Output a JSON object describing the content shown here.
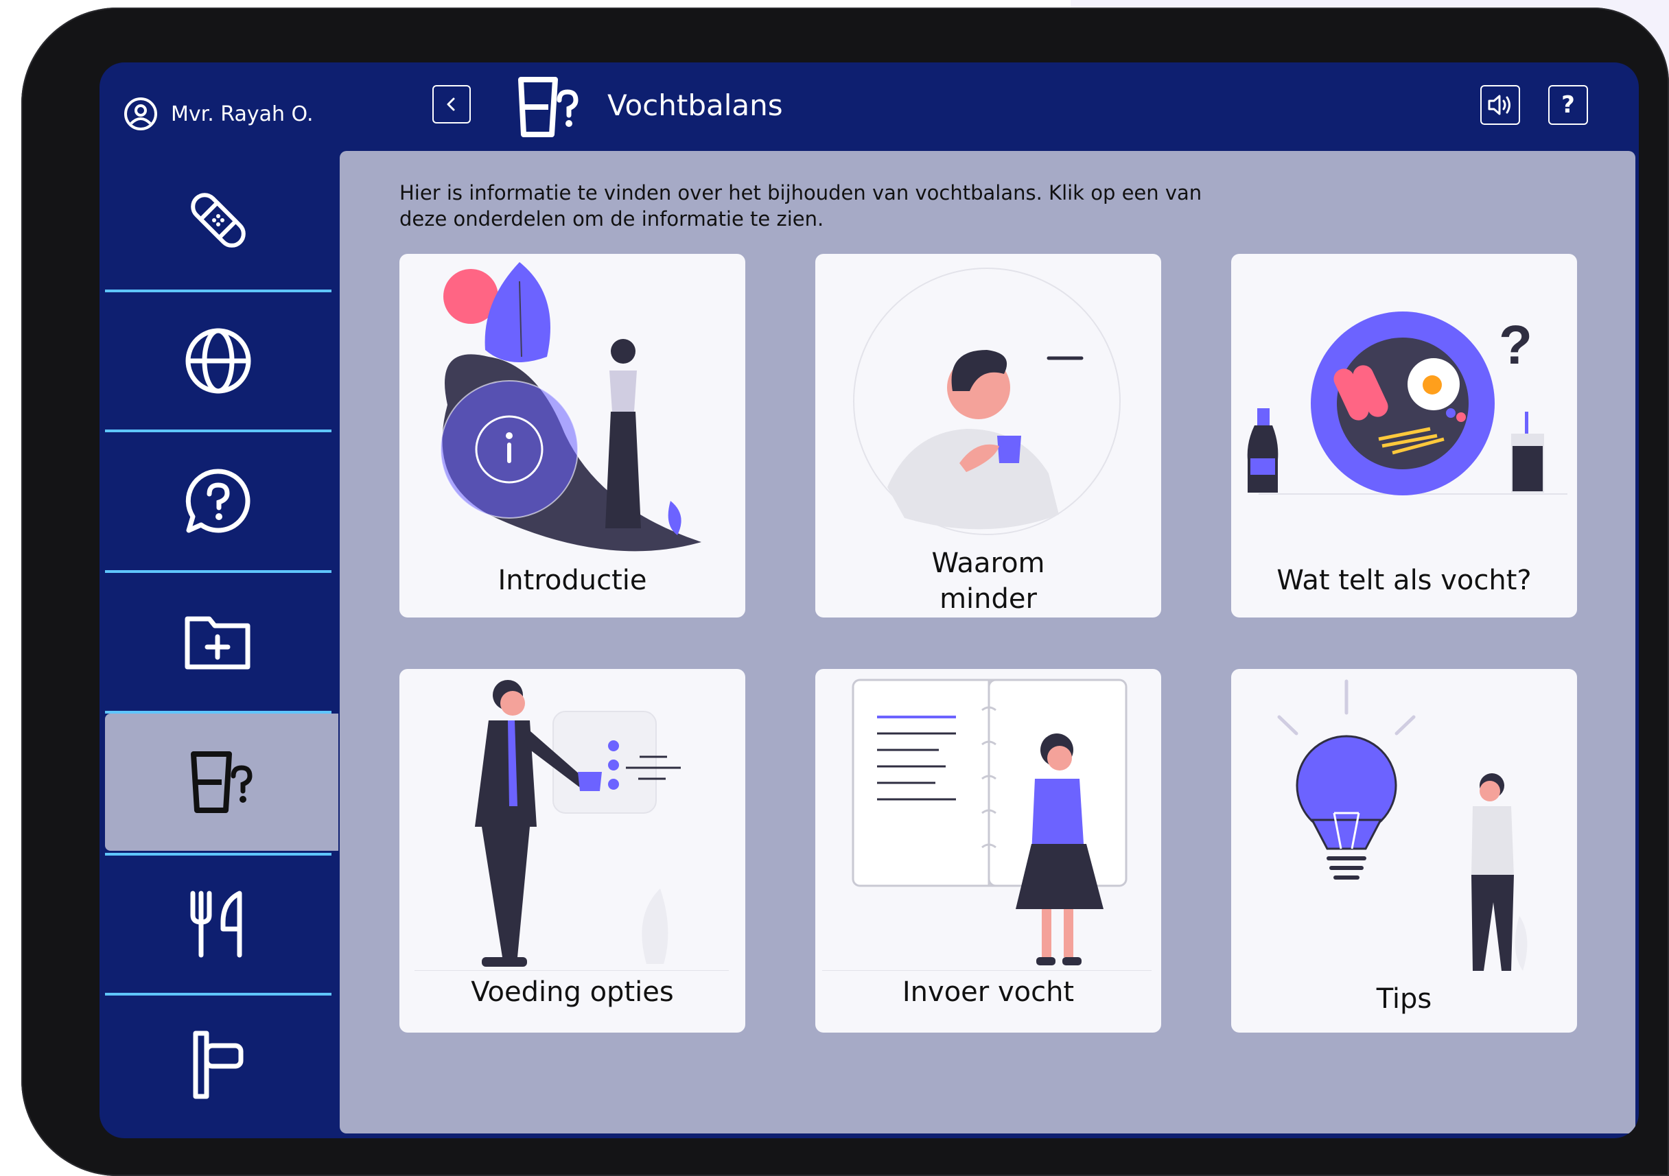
{
  "header": {
    "user_name": "Mvr. Rayah O.",
    "title": "Vochtbalans",
    "help_label": "?"
  },
  "sidebar": {
    "items": [
      {
        "icon": "bandage-icon"
      },
      {
        "icon": "globe-icon"
      },
      {
        "icon": "question-chat-icon"
      },
      {
        "icon": "folder-plus-icon"
      },
      {
        "icon": "cup-question-icon",
        "active": true
      },
      {
        "icon": "fork-knife-icon"
      },
      {
        "icon": "signpost-icon"
      }
    ]
  },
  "main": {
    "intro_text": "Hier is informatie te vinden over het bijhouden van vochtbalans. Klik op een van deze onderdelen om de informatie te zien.",
    "cards": [
      {
        "label": "Introductie"
      },
      {
        "label": "Waarom minder drinken?"
      },
      {
        "label": "Wat telt als vocht?"
      },
      {
        "label": "Voeding opties"
      },
      {
        "label": "Invoer vocht"
      },
      {
        "label": "Tips"
      }
    ]
  },
  "colors": {
    "navy": "#0e1f70",
    "panel": "#a6aac6",
    "accent": "#6c63ff",
    "divider": "#5fc6ff"
  }
}
